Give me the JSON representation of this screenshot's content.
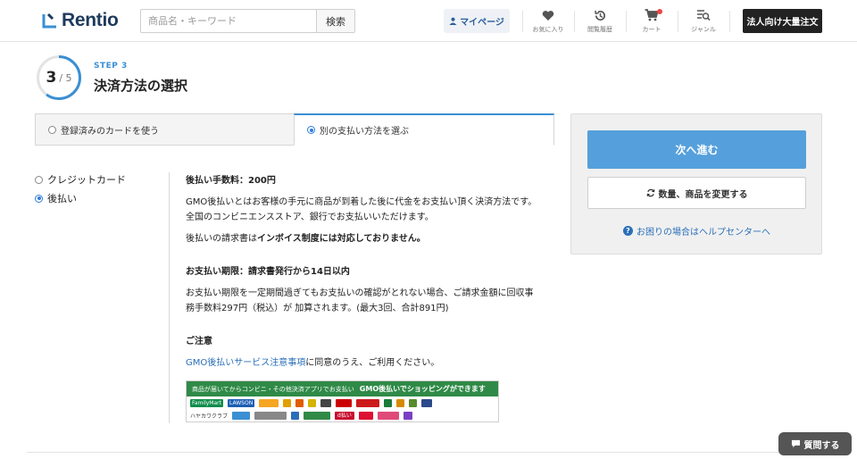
{
  "header": {
    "logo_text": "Rentio",
    "search_placeholder": "商品名・キーワード",
    "search_button": "検索",
    "mypage": "マイページ",
    "nav": [
      {
        "label": "お気に入り",
        "icon": "heart-icon"
      },
      {
        "label": "閲覧履歴",
        "icon": "history-icon"
      },
      {
        "label": "カート",
        "icon": "cart-icon"
      },
      {
        "label": "ジャンル",
        "icon": "genre-icon"
      }
    ],
    "corp_order": "法人向け大量注文"
  },
  "step": {
    "current": "3",
    "total": "/ 5",
    "label": "STEP 3",
    "title": "決済方法の選択",
    "progress_fraction": 0.6
  },
  "tabs": [
    {
      "label": "登録済みのカードを使う",
      "selected": false
    },
    {
      "label": "別の支払い方法を選ぶ",
      "selected": true
    }
  ],
  "methods": [
    {
      "label": "クレジットカード",
      "selected": false
    },
    {
      "label": "後払い",
      "selected": true
    }
  ],
  "content": {
    "fee_heading": "後払い手数料：200円",
    "desc_line1": "GMO後払いとはお客様の手元に商品が到着した後に代金をお支払い頂く決済方法です。",
    "desc_line2": "全国のコンビニエンスストア、銀行でお支払いいただけます。",
    "invoice_prefix": "後払いの請求書は",
    "invoice_bold": "インボイス制度には対応しておりません。",
    "deadline_heading": "お支払い期限：請求書発行から14日以内",
    "deadline_desc1": "お支払い期限を一定期間過ぎてもお支払いの確認がとれない場合、ご請求金額に回収事",
    "deadline_desc2": "務手数料297円（税込）が 加算されます。(最大3回、合計891円)",
    "notice_heading": "ご注意",
    "notice_link": "GMO後払いサービス注意事項",
    "notice_suffix": "に同意のうえ、ご利用ください。"
  },
  "banner": {
    "top_text": "商品が届いてからコンビニ・その他決済アプリでお支払い",
    "top_brand": "GMO後払いでショッピングができます",
    "row1": [
      "FamilyMart",
      "LAWSON"
    ],
    "row2": [
      "ハヤカワクラブ",
      "d払い"
    ]
  },
  "panel": {
    "next": "次へ進む",
    "change": "数量、商品を変更する",
    "help": "お困りの場合はヘルプセンターへ"
  },
  "chat": "質問する",
  "colors": {
    "accent": "#3b8fd3",
    "next_button": "#55a0dc",
    "link": "#2a6fb8",
    "logo": "#1e3a5c"
  }
}
